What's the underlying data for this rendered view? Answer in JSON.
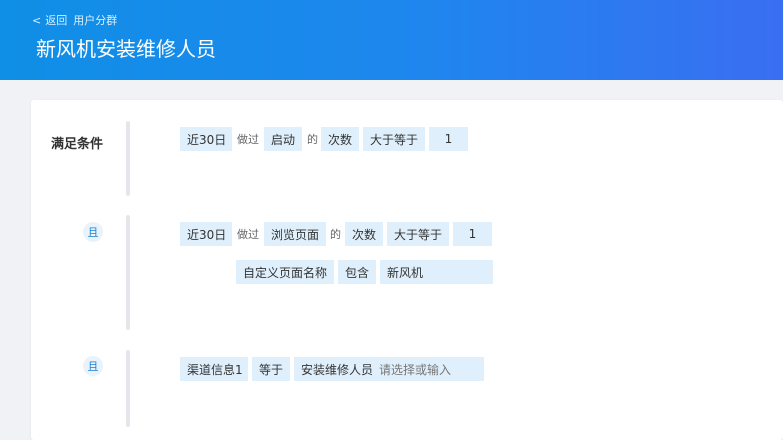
{
  "header": {
    "back_arrow": "<",
    "back_label": "返回",
    "back_target": "用户分群",
    "title": "新风机安装维修人员",
    "gradient": [
      "#0f8fe6",
      "#3a6ef2"
    ]
  },
  "conditions": {
    "title": "满足条件",
    "and_label": "且",
    "rule1": {
      "time": "近30日",
      "did": "做过",
      "event": "启动",
      "of": "的",
      "metric": "次数",
      "operator": "大于等于",
      "value": "1"
    },
    "rule2": {
      "time": "近30日",
      "did": "做过",
      "event": "浏览页面",
      "of": "的",
      "metric": "次数",
      "operator": "大于等于",
      "value": "1",
      "filter_property": "自定义页面名称",
      "filter_operator": "包含",
      "filter_value": "新风机"
    },
    "rule3": {
      "property": "渠道信息1",
      "operator": "等于",
      "value": "安装维修人员",
      "placeholder": "请选择或输入"
    }
  },
  "colors": {
    "chip_bg": "#dff0fc",
    "badge_bg": "#e8f3fc",
    "badge_text": "#1a7fd0"
  }
}
